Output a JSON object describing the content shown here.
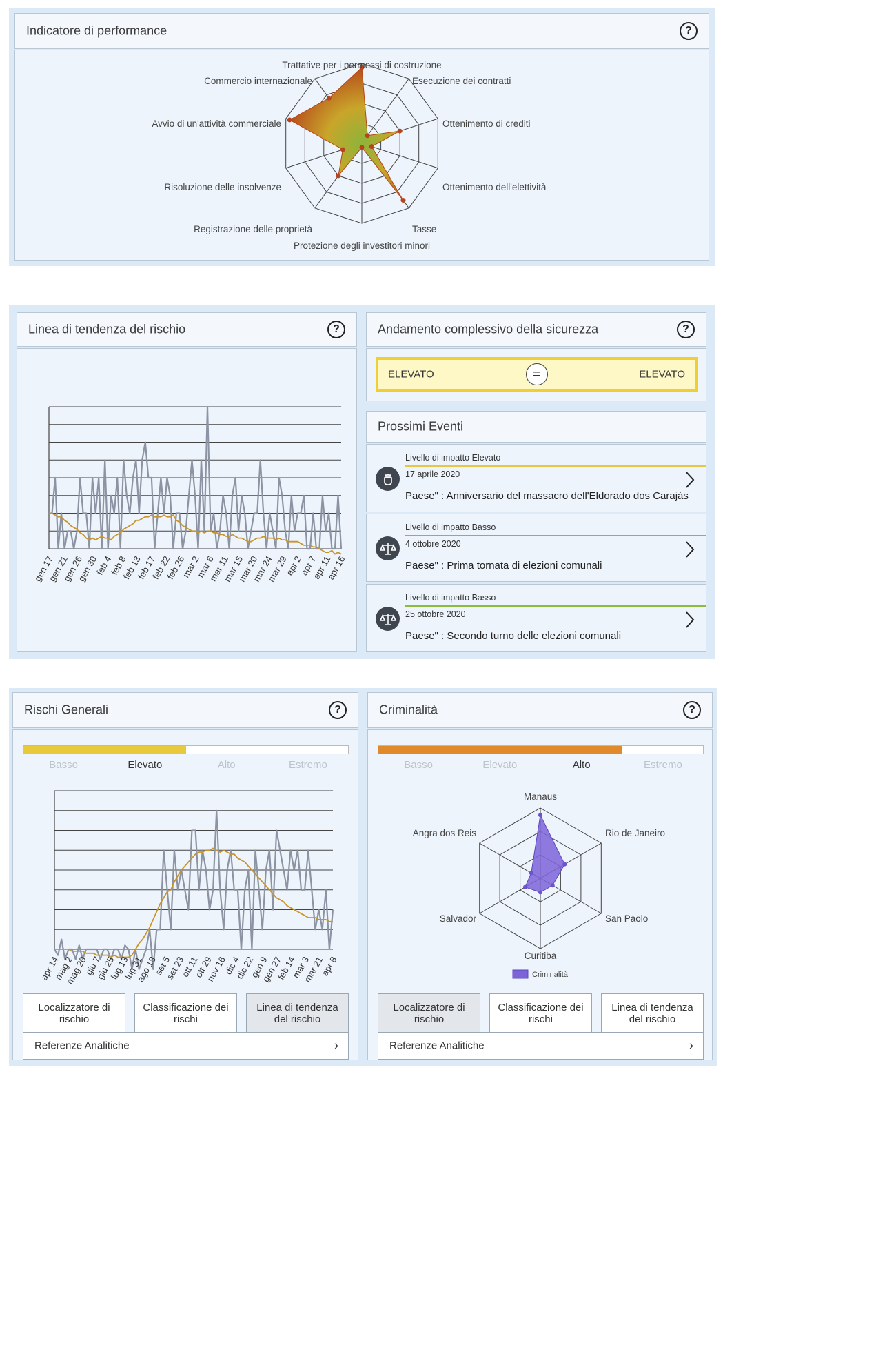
{
  "performance": {
    "title": "Indicatore di performance",
    "chart_data": {
      "type": "radar",
      "axes": [
        "Trattative per i permessi di costruzione",
        "Esecuzione dei contratti",
        "Ottenimento di crediti",
        "Ottenimento dell'elettività",
        "Tasse",
        "Protezione degli investitori minori",
        "Registrazione delle proprietà",
        "Risoluzione delle insolvenze",
        "Avvio di un'attività commerciale",
        "Commercio internazionale"
      ],
      "values": [
        0.95,
        0.12,
        0.5,
        0.13,
        0.88,
        0.05,
        0.5,
        0.25,
        0.95,
        0.7
      ],
      "max": 1,
      "colors": {
        "outer": "#b5451a",
        "mid": "#c9a52a",
        "center": "#8db43a",
        "point": "#b5451a"
      }
    }
  },
  "trend": {
    "title": "Linea di tendenza del rischio",
    "chart_data": {
      "type": "line",
      "x_labels": [
        "gen 17",
        "gen 21",
        "gen 26",
        "gen 30",
        "feb 4",
        "feb 8",
        "feb 13",
        "feb 17",
        "feb 22",
        "feb 26",
        "mar 2",
        "mar 6",
        "mar 11",
        "mar 15",
        "mar 20",
        "mar 24",
        "mar 29",
        "apr 2",
        "apr 7",
        "apr 11",
        "apr 16"
      ],
      "ylim": [
        0,
        8
      ],
      "series": [
        {
          "color": "#8c94a3",
          "values": [
            2,
            2,
            4,
            0,
            2,
            0,
            1,
            1,
            0,
            1,
            4,
            2,
            2,
            0,
            4,
            2,
            4,
            0,
            5,
            0,
            3,
            2,
            4,
            0,
            5,
            3,
            2,
            4,
            5,
            2,
            5,
            6,
            4,
            4,
            0,
            2,
            4,
            2,
            4,
            3,
            0,
            2,
            2,
            0,
            1,
            3,
            5,
            3,
            0,
            5,
            1,
            8,
            1,
            2,
            0,
            1,
            3,
            2,
            0,
            3,
            4,
            1,
            3,
            2,
            0,
            1,
            2,
            2,
            5,
            2,
            0,
            2,
            1,
            0,
            4,
            3,
            1,
            0,
            3,
            1,
            2,
            2,
            3,
            0,
            0,
            2,
            0,
            0,
            3,
            1,
            2,
            0,
            0,
            3,
            0
          ]
        },
        {
          "color": "#c9952b",
          "values": [
            2,
            2,
            1.9,
            1.8,
            1.8,
            1.6,
            1.5,
            1.3,
            1.2,
            1.1,
            0.9,
            0.8,
            0.6,
            0.5,
            0.6,
            0.5,
            0.6,
            0.7,
            0.6,
            0.6,
            0.5,
            0.7,
            0.8,
            0.9,
            1.1,
            1.2,
            1.3,
            1.4,
            1.6,
            1.6,
            1.7,
            1.8,
            1.8,
            1.9,
            1.8,
            1.8,
            1.8,
            1.9,
            1.8,
            1.8,
            1.9,
            1.6,
            1.5,
            1.3,
            1.2,
            1.1,
            1,
            1,
            0.9,
            1,
            0.9,
            1,
            1,
            0.9,
            0.9,
            0.8,
            0.8,
            0.7,
            0.7,
            0.8,
            0.7,
            0.6,
            0.6,
            0.5,
            0.4,
            0.4,
            0.5,
            0.6,
            0.6,
            0.7,
            0.6,
            0.6,
            0.6,
            0.5,
            0.6,
            0.5,
            0.5,
            0.4,
            0.4,
            0.4,
            0.4,
            0.3,
            0.2,
            0.2,
            0.2,
            0.1,
            0.1,
            0,
            -0.1,
            -0.2,
            -0.2,
            -0.1,
            -0.3,
            -0.2,
            -0.3
          ]
        }
      ]
    }
  },
  "security": {
    "title": "Andamento complessivo della sicurezza",
    "left": "ELEVATO",
    "right": "ELEVATO",
    "symbol": "="
  },
  "events": {
    "title": "Prossimi Eventi",
    "items": [
      {
        "impact": "Livello di impatto Elevato",
        "date": "17 aprile 2020",
        "desc": "Paese\" : Anniversario del massacro dell'Eldorado dos Carajás",
        "line_color": "#e7c642",
        "icon": "raised-fist-icon"
      },
      {
        "impact": "Livello di impatto Basso",
        "date": "4 ottobre 2020",
        "desc": "Paese\" : Prima tornata di elezioni comunali",
        "line_color": "#8dbb3d",
        "icon": "scales-icon"
      },
      {
        "impact": "Livello di impatto Basso",
        "date": "25 ottobre 2020",
        "desc": "Paese\" : Secondo turno delle elezioni comunali",
        "line_color": "#8dbb3d",
        "icon": "scales-icon"
      }
    ]
  },
  "general": {
    "title": "Rischi Generali",
    "level_fill_percent": 50,
    "level_color": "#e8c93b",
    "levels": [
      "Basso",
      "Elevato",
      "Alto",
      "Estremo"
    ],
    "active_level": 1,
    "chart_data": {
      "type": "line",
      "x_labels": [
        "apr 14",
        "mag 2",
        "mag 20",
        "giu 7",
        "giu 25",
        "lug 13",
        "lug 31",
        "ago 18",
        "set 5",
        "set 23",
        "ott 11",
        "ott 29",
        "nov 16",
        "dic 4",
        "dic 22",
        "gen 9",
        "gen 27",
        "feb 14",
        "mar 3",
        "mar 21",
        "apr 8"
      ],
      "ylim": [
        0,
        8
      ],
      "series": [
        {
          "color": "#8c94a3",
          "values": [
            0,
            -0.3,
            0.5,
            -0.5,
            0,
            0,
            -0.5,
            0.2,
            -0.5,
            0,
            0,
            0,
            0,
            -0.5,
            0,
            0,
            -0.5,
            0,
            0,
            -0.5,
            0.2,
            0,
            -1,
            0,
            -1,
            -0.5,
            0,
            1,
            -1,
            1,
            1,
            5,
            3,
            1,
            5,
            3,
            4,
            3,
            2,
            6,
            6,
            3,
            5,
            4,
            2,
            3,
            7,
            3,
            1,
            4,
            5,
            3,
            3,
            0,
            3,
            4,
            0,
            5,
            3,
            1,
            4,
            5,
            2,
            6,
            5,
            4,
            3,
            5,
            4,
            5,
            3,
            3,
            5,
            3,
            1,
            2,
            1,
            3,
            0,
            2
          ]
        },
        {
          "color": "#c9952b",
          "values": [
            0,
            0,
            0,
            0,
            0,
            -0.1,
            -0.1,
            -0.1,
            -0.1,
            -0.2,
            -0.2,
            -0.2,
            -0.3,
            -0.3,
            -0.3,
            -0.3,
            -0.4,
            -0.3,
            -0.4,
            -0.4,
            -0.4,
            -0.4,
            -0.3,
            0,
            0.3,
            0.5,
            0.8,
            1.1,
            1.5,
            1.9,
            2.3,
            2.6,
            2.9,
            3,
            3.4,
            3.7,
            4,
            4.2,
            4.4,
            4.6,
            4.8,
            4.9,
            4.9,
            5,
            5,
            5.1,
            5,
            4.9,
            5,
            4.9,
            4.8,
            4.8,
            4.6,
            4.5,
            4.4,
            4.2,
            4,
            3.8,
            3.6,
            3.4,
            3.2,
            3,
            2.8,
            2.6,
            2.5,
            2.4,
            2.2,
            2.1,
            2,
            1.9,
            1.8,
            1.7,
            1.6,
            1.6,
            1.6,
            1.5,
            1.5,
            1.5,
            1.4,
            1.4
          ]
        }
      ]
    },
    "buttons": [
      "Localizzatore di rischio",
      "Classificazione dei rischi",
      "Linea di tendenza del rischio"
    ],
    "active_button": 2,
    "ref": "Referenze Analitiche"
  },
  "crime": {
    "title": "Criminalità",
    "level_fill_percent": 75,
    "level_color": "#e08a2b",
    "levels": [
      "Basso",
      "Elevato",
      "Alto",
      "Estremo"
    ],
    "active_level": 2,
    "chart_data": {
      "type": "radar",
      "axes": [
        "Manaus",
        "Rio de Janeiro",
        "San Paolo",
        "Curitiba",
        "Salvador",
        "Angra dos Reis"
      ],
      "series": [
        {
          "name": "Criminalità",
          "color": "#7c64d8",
          "values": [
            0.9,
            0.4,
            0.2,
            0.2,
            0.25,
            0.15
          ]
        }
      ],
      "max": 1
    },
    "legend": "Criminalità",
    "buttons": [
      "Localizzatore di rischio",
      "Classificazione dei rischi",
      "Linea di tendenza del rischio"
    ],
    "active_button": 0,
    "ref": "Referenze Analitiche"
  }
}
